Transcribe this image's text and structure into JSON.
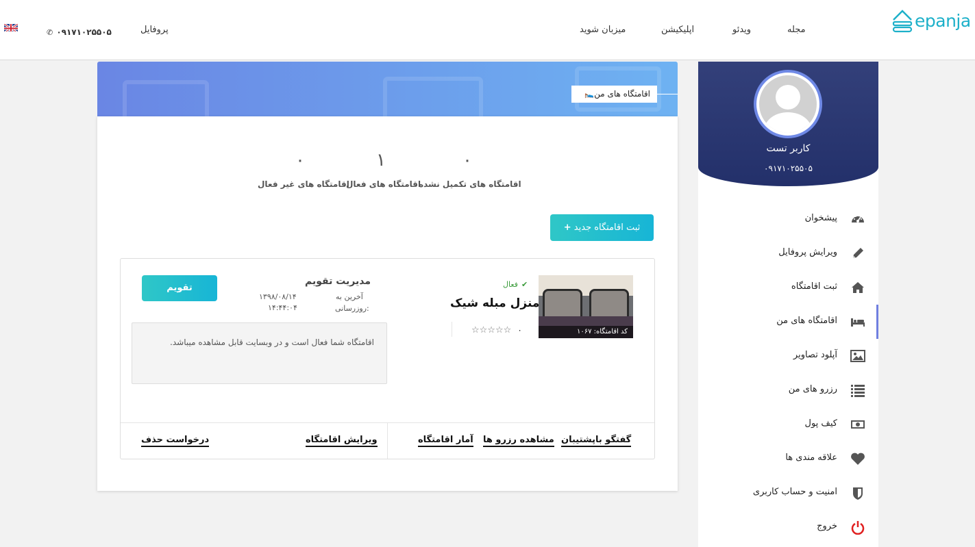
{
  "header": {
    "logo_text": "epanja",
    "nav": [
      "مجله",
      "ویدئو",
      "اپلیکیشن",
      "میزبان شوید",
      "پروفایل"
    ],
    "phone": "۰۹۱۷۱۰۲۵۵۰۵"
  },
  "sidebar": {
    "user_name": "کاربر تست",
    "user_phone": "۰۹۱۷۱۰۲۵۵۰۵",
    "items": [
      {
        "label": "پیشخوان",
        "icon": "dashboard-icon"
      },
      {
        "label": "ویرایش پروفایل",
        "icon": "pencil-icon"
      },
      {
        "label": "ثبت اقامتگاه",
        "icon": "home-icon"
      },
      {
        "label": "اقامتگاه های من",
        "icon": "bed-icon",
        "active": true
      },
      {
        "label": "آپلود تصاویر",
        "icon": "image-icon"
      },
      {
        "label": "رزرو های من",
        "icon": "list-icon"
      },
      {
        "label": "کیف پول",
        "icon": "money-icon"
      },
      {
        "label": "علاقه مندی ها",
        "icon": "heart-icon"
      },
      {
        "label": "امنیت و حساب کاربری",
        "icon": "shield-icon"
      },
      {
        "label": "خروج",
        "icon": "power-icon"
      }
    ]
  },
  "banner": {
    "tag": "اقامتگاه های من"
  },
  "stats": [
    {
      "value": "۰",
      "label": "اقامتگاه های تکمیل نشده"
    },
    {
      "value": "۱",
      "label": "اقامتگاه های فعال"
    },
    {
      "value": "۰",
      "label": "اقامتگاه های غیر فعال"
    }
  ],
  "new_button": "ثبت اقامتگاه جدید",
  "listing": {
    "status": "فعال",
    "title": "منزل مبله شیک",
    "rating": "۰",
    "code": "کد اقامتگاه: ۱۰۶۷",
    "calendar_title": "مدیریت تقویم",
    "last_update_label_1": "آخرین به",
    "last_update_label_2": "روزرسانی:",
    "last_update_date": "۱۳۹۸/۰۸/۱۴",
    "last_update_time": "۱۴:۴۴:۰۴",
    "calendar_button": "تقویم",
    "message": "اقامتگاه شما فعال است و در وبسایت قابل مشاهده میباشد.",
    "links": [
      "گفتگو باپشتیبان",
      "مشاهده رزرو ها",
      "آمار اقامتگاه",
      "ویرایش اقامتگاه",
      "درخواست حذف"
    ]
  },
  "colors": {
    "accent": "#1db0c9",
    "sidebar_dark": "#23306a",
    "banner_start": "#6a86e4",
    "banner_end": "#6eb2f2",
    "active_green": "#3a9b3a"
  }
}
